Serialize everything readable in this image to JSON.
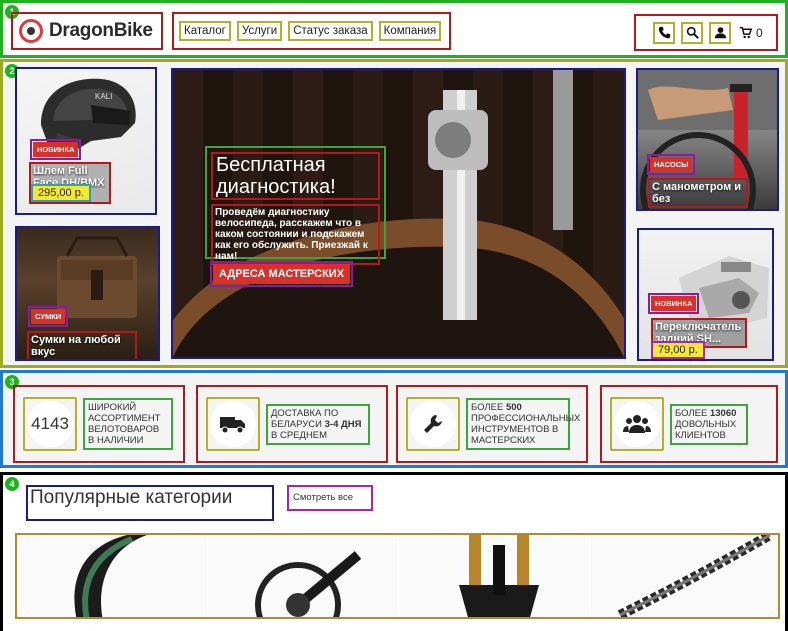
{
  "header": {
    "logo_text": "DragonBike",
    "nav": [
      "Каталог",
      "Услуги",
      "Статус заказа",
      "Компания"
    ],
    "cart_count": "0"
  },
  "hero": {
    "card1": {
      "badge": "НОВИНКА",
      "title": "Шлем Full Face DH/BMX Zok...",
      "price": "295,00 р."
    },
    "card2": {
      "badge": "СУМКИ",
      "title": "Сумки на любой вкус"
    },
    "main": {
      "heading": "Бесплатная диагностика!",
      "text": "Проведём диагностику велосипеда, расскажем что в каком состоянии и подскажем как его обслужить. Приезжай к нам!",
      "button": "АДРЕСА МАСТЕРСКИХ"
    },
    "card3": {
      "badge": "НАСОСЫ",
      "title": "С манометром и без"
    },
    "card4": {
      "badge": "НОВИНКА",
      "title": "Переключатель задний SH...",
      "price": "79,00 р."
    }
  },
  "features": [
    {
      "icon": "4143",
      "text": "ШИРОКИЙ АССОРТИМЕНТ ВЕЛОТОВАРОВ В НАЛИЧИИ"
    },
    {
      "icon": "truck-icon",
      "text_pre": "ДОСТАВКА ПО БЕЛАРУСИ ",
      "text_bold": "3-4 ДНЯ",
      "text_post": " В СРЕДНЕМ"
    },
    {
      "icon": "wrench-icon",
      "text_pre": "БОЛЕЕ ",
      "text_bold": "500",
      "text_post": " ПРОФЕССИОНАЛЬНЫХ ИНСТРУМЕНТОВ В МАСТЕРСКИХ"
    },
    {
      "icon": "users-icon",
      "text_pre": "БОЛЕЕ ",
      "text_bold": "13060",
      "text_post": " ДОВОЛЬНЫХ КЛИЕНТОВ"
    }
  ],
  "categories": {
    "title": "Популярные категории",
    "see_all": "Смотреть все"
  },
  "section_tags": [
    "1",
    "2",
    "3",
    "4"
  ],
  "colors": {
    "accent": "#d9302a",
    "price_bg": "#f4e92a"
  }
}
